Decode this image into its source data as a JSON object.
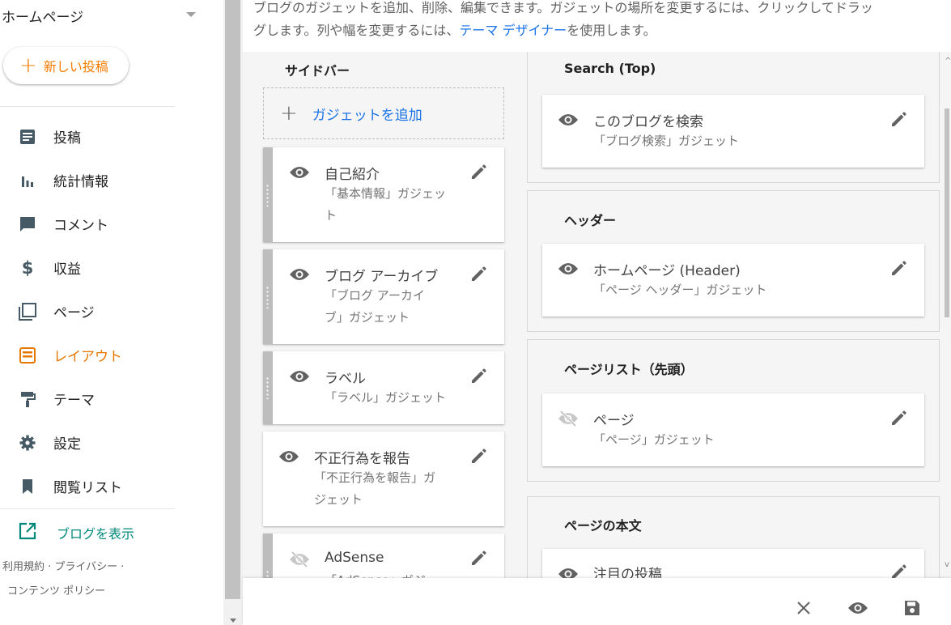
{
  "sidebar": {
    "blog_name": "ホームページ",
    "new_post_label": "新しい投稿",
    "items": [
      {
        "label": "投稿",
        "icon": "posts-icon"
      },
      {
        "label": "統計情報",
        "icon": "stats-icon"
      },
      {
        "label": "コメント",
        "icon": "comment-icon"
      },
      {
        "label": "収益",
        "icon": "dollar-icon"
      },
      {
        "label": "ページ",
        "icon": "pages-icon"
      },
      {
        "label": "レイアウト",
        "icon": "layout-icon",
        "active": true
      },
      {
        "label": "テーマ",
        "icon": "paint-roller-icon"
      },
      {
        "label": "設定",
        "icon": "gear-icon"
      },
      {
        "label": "閲覧リスト",
        "icon": "bookmark-icon"
      }
    ],
    "view_blog_label": "ブログを表示",
    "footer_line1": "利用規約 · プライバシー ·",
    "footer_line2": "コンテンツ ポリシー"
  },
  "main": {
    "desc_part1": "ブログのガジェットを追加、削除、編集できます。ガジェットの場所を変更するには、クリックしてドラッ",
    "desc_part2": "グします。列や幅を変更するには、",
    "desc_link": "テーマ デザイナー",
    "desc_part3": "を使用します。"
  },
  "sidebar_column": {
    "title": "サイドバー",
    "add_gadget": "ガジェットを追加",
    "gadgets": [
      {
        "title": "自己紹介",
        "sub1": "「基本情報」ガジェッ",
        "sub2": "ト",
        "visible": true
      },
      {
        "title": "ブログ アーカイブ",
        "sub1": "「ブログ アーカイ",
        "sub2": "ブ」ガジェット",
        "visible": true
      },
      {
        "title": "ラベル",
        "sub1": "「ラベル」ガジェット",
        "sub2": "",
        "visible": true
      },
      {
        "title": "不正行為を報告",
        "sub1": "「不正行為を報告」ガ",
        "sub2": "ジェット",
        "visible": true
      },
      {
        "title": "AdSense",
        "sub1": "「AdSense」ガジェ",
        "sub2": "",
        "visible": false
      }
    ]
  },
  "sections": [
    {
      "title": "Search (Top)",
      "gadget_title": "このブログを検索",
      "gadget_sub": "「ブログ検索」ガジェット",
      "visible": true
    },
    {
      "title": "ヘッダー",
      "gadget_title": "ホームページ (Header)",
      "gadget_sub": "「ページ ヘッダー」ガジェット",
      "visible": true
    },
    {
      "title": "ページリスト（先頭）",
      "gadget_title": "ページ",
      "gadget_sub": "「ページ」ガジェット",
      "visible": false
    },
    {
      "title": "ページの本文",
      "gadget_title": "注目の投稿",
      "gadget_sub": "",
      "visible": true
    }
  ],
  "colors": {
    "accent": "#e67700",
    "link": "#1a73e8",
    "teal": "#00897b"
  }
}
